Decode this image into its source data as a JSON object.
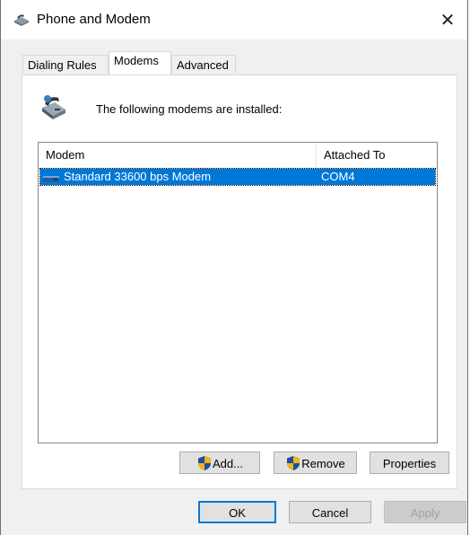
{
  "window": {
    "title": "Phone and Modem",
    "close_label": "✕"
  },
  "tabs": [
    {
      "label": "Dialing Rules",
      "selected": false
    },
    {
      "label": "Modems",
      "selected": true
    },
    {
      "label": "Advanced",
      "selected": false
    }
  ],
  "modems_tab": {
    "caption": "The following modems are installed:",
    "columns": [
      "Modem",
      "Attached To"
    ],
    "rows": [
      {
        "modem": "Standard 33600 bps Modem",
        "attached_to": "COM4",
        "selected": true
      }
    ],
    "buttons": {
      "add": "Add...",
      "remove": "Remove",
      "properties": "Properties"
    }
  },
  "dialog_buttons": {
    "ok": "OK",
    "cancel": "Cancel",
    "apply": "Apply"
  },
  "colors": {
    "selection": "#0078d7",
    "window_bg": "#f0f0f0"
  },
  "icons": {
    "title": "phone-modem-icon",
    "header": "modem-device-icon",
    "row": "modem-small-icon",
    "uac": "uac-shield-icon"
  }
}
